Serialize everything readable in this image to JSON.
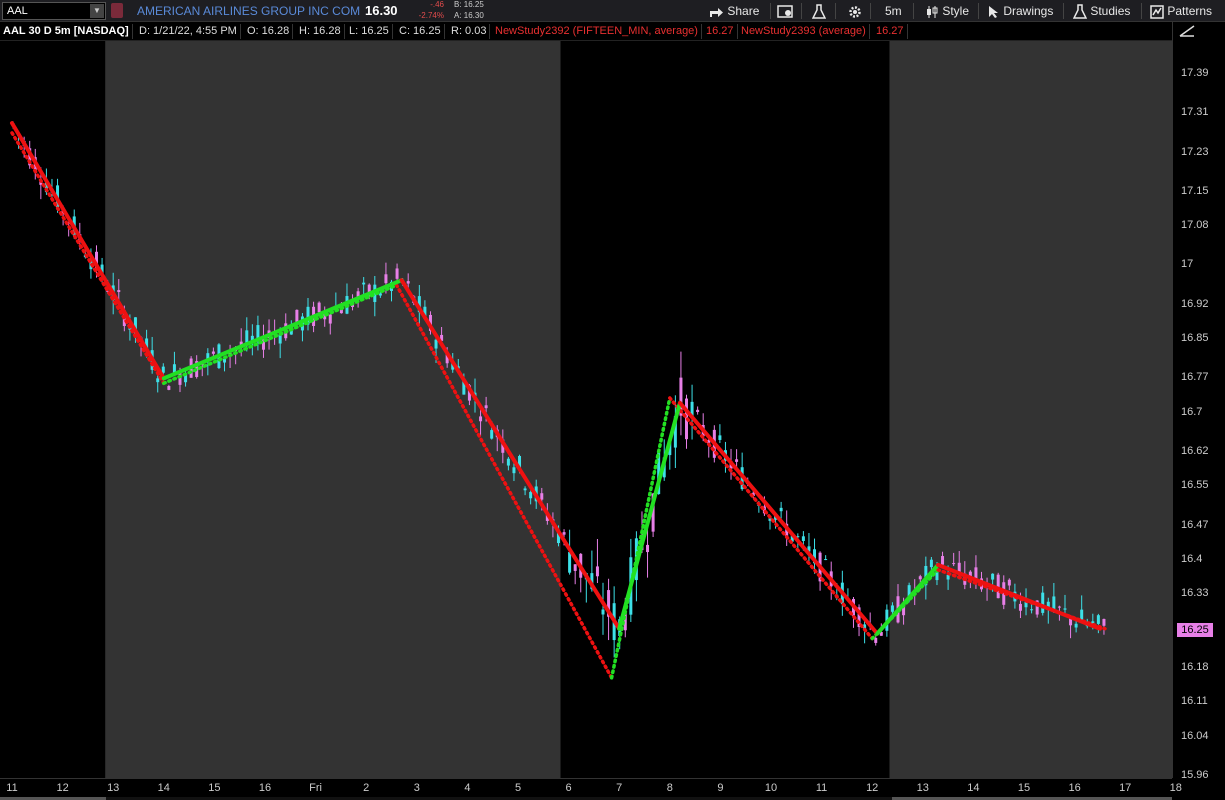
{
  "toolbar": {
    "symbol": "AAL",
    "company": "AMERICAN AIRLINES GROUP INC COM",
    "last": "16.30",
    "change": "-.46",
    "change_pct": "-2.74%",
    "bid": "B: 16.25",
    "ask": "A: 16.30",
    "share_label": "Share",
    "interval_label": "5m",
    "style_label": "Style",
    "drawings_label": "Drawings",
    "studies_label": "Studies",
    "patterns_label": "Patterns"
  },
  "info": {
    "ticker": "AAL 30 D 5m [NASDAQ]",
    "date": "D: 1/21/22, 4:55 PM",
    "open": "O: 16.28",
    "high": "H: 16.28",
    "low": "L: 16.25",
    "close": "C: 16.25",
    "range": "R: 0.03",
    "study1": "NewStudy2392 (FIFTEEN_MIN, average)",
    "study1_val": "16.27",
    "study2": "NewStudy2393 (average)",
    "study2_val": "16.27"
  },
  "axis": {
    "current_price": "16.25",
    "price_ticks": [
      "17.39",
      "17.31",
      "17.23",
      "17.15",
      "17.08",
      "17",
      "16.92",
      "16.85",
      "16.77",
      "16.7",
      "16.62",
      "16.55",
      "16.47",
      "16.4",
      "16.33",
      "16.25",
      "16.18",
      "16.11",
      "16.04",
      "15.96"
    ],
    "time_ticks": [
      "11",
      "12",
      "13",
      "14",
      "15",
      "16",
      "Fri",
      "2",
      "3",
      "4",
      "5",
      "6",
      "7",
      "8",
      "9",
      "10",
      "11",
      "12",
      "13",
      "14",
      "15",
      "16",
      "17",
      "18"
    ]
  },
  "chart_data": {
    "type": "candlestick",
    "symbol": "AAL",
    "interval": "5m",
    "ylim": [
      15.96,
      17.43
    ],
    "x_ticks": [
      "11",
      "12",
      "13",
      "14",
      "15",
      "16",
      "Fri",
      "2",
      "3",
      "4",
      "5",
      "6",
      "7",
      "8",
      "9",
      "10",
      "11",
      "12",
      "13",
      "14",
      "15",
      "16",
      "17",
      "18"
    ],
    "sessions": [
      {
        "type": "after-hours",
        "x_from": 0,
        "x_to": 2.0
      },
      {
        "type": "regular",
        "x_from": 2.0,
        "x_to": 11.0
      },
      {
        "type": "after-hours",
        "x_from": 11.0,
        "x_to": 17.5
      },
      {
        "type": "regular",
        "x_from": 17.5,
        "x_to": 23.0
      }
    ],
    "zigzag_fifteen_min": [
      {
        "x": 0.0,
        "y": 17.29
      },
      {
        "x": 3.0,
        "y": 16.77
      },
      {
        "x": 7.7,
        "y": 16.97
      },
      {
        "x": 12.0,
        "y": 16.26
      },
      {
        "x": 13.2,
        "y": 16.72
      },
      {
        "x": 17.1,
        "y": 16.25
      },
      {
        "x": 18.3,
        "y": 16.39
      },
      {
        "x": 21.5,
        "y": 16.26
      }
    ],
    "zigzag_average": [
      {
        "x": 0.0,
        "y": 17.27
      },
      {
        "x": 3.0,
        "y": 16.76
      },
      {
        "x": 7.6,
        "y": 16.96
      },
      {
        "x": 11.85,
        "y": 16.16
      },
      {
        "x": 13.0,
        "y": 16.73
      },
      {
        "x": 17.0,
        "y": 16.24
      },
      {
        "x": 18.3,
        "y": 16.38
      },
      {
        "x": 21.6,
        "y": 16.26
      }
    ],
    "colors": {
      "up": "#3de0e8",
      "down": "#e77fe7",
      "zig_up": "#22e022",
      "zig_down": "#ee1111",
      "session": "#333333",
      "after_hours": "#000000"
    }
  }
}
